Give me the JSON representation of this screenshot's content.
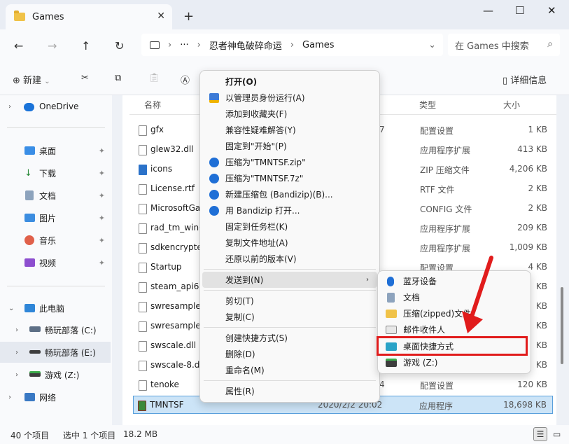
{
  "window": {
    "tab_title": "Games",
    "close_glyph": "✕",
    "newtab_glyph": "+",
    "min_glyph": "—",
    "max_glyph": "☐",
    "winclose_glyph": "✕"
  },
  "nav": {
    "back": "←",
    "forward": "→",
    "up": "↑",
    "refresh": "↻",
    "breadcrumb": [
      "忍者神龟破碎命运",
      "Games"
    ],
    "ellipsis": "···",
    "search_placeholder": "在 Games 中搜索"
  },
  "toolbar": {
    "new_label": "新建",
    "details_label": "详细信息"
  },
  "sidebar": {
    "items": [
      {
        "label": "OneDrive"
      },
      {
        "label": "桌面"
      },
      {
        "label": "下载"
      },
      {
        "label": "文档"
      },
      {
        "label": "图片"
      },
      {
        "label": "音乐"
      },
      {
        "label": "视频"
      },
      {
        "label": "此电脑"
      },
      {
        "label": "畅玩部落 (C:)"
      },
      {
        "label": "畅玩部落 (E:)"
      },
      {
        "label": "游戏 (Z:)"
      },
      {
        "label": "网络"
      }
    ]
  },
  "columns": {
    "name": "名称",
    "type": "类型",
    "size": "大小"
  },
  "files": [
    {
      "name": "gfx",
      "date": "7",
      "type": "配置设置",
      "size": "1 KB"
    },
    {
      "name": "glew32.dll",
      "date": "",
      "type": "应用程序扩展",
      "size": "413 KB"
    },
    {
      "name": "icons",
      "date": "",
      "type": "ZIP 压缩文件",
      "size": "4,206 KB"
    },
    {
      "name": "License.rtf",
      "date": "",
      "type": "RTF 文件",
      "size": "2 KB"
    },
    {
      "name": "MicrosoftGa",
      "date": "",
      "type": "CONFIG 文件",
      "size": "2 KB"
    },
    {
      "name": "rad_tm_win6",
      "date": "",
      "type": "应用程序扩展",
      "size": "209 KB"
    },
    {
      "name": "sdkencrypte",
      "date": "",
      "type": "应用程序扩展",
      "size": "1,009 KB"
    },
    {
      "name": "Startup",
      "date": "",
      "type": "配置设置",
      "size": "4 KB"
    },
    {
      "name": "steam_api64",
      "date": "",
      "type": "",
      "size": "KB"
    },
    {
      "name": "swresample",
      "date": "",
      "type": "",
      "size": "KB"
    },
    {
      "name": "swresample",
      "date": "",
      "type": "",
      "size": "KB"
    },
    {
      "name": "swscale.dll",
      "date": "",
      "type": "",
      "size": "KB"
    },
    {
      "name": "swscale-8.dl",
      "date": "",
      "type": "",
      "size": "KB"
    },
    {
      "name": "tenoke",
      "date": "4",
      "type": "配置设置",
      "size": "120 KB"
    },
    {
      "name": "TMNTSF",
      "date": "2020/2/2 20:02",
      "type": "应用程序",
      "size": "18,698 KB"
    }
  ],
  "context_menu": [
    {
      "label": "打开(O)"
    },
    {
      "label": "以管理员身份运行(A)"
    },
    {
      "label": "添加到收藏夹(F)"
    },
    {
      "label": "兼容性疑难解答(Y)"
    },
    {
      "label": "固定到\"开始\"(P)"
    },
    {
      "label": "压缩为\"TMNTSF.zip\""
    },
    {
      "label": "压缩为\"TMNTSF.7z\""
    },
    {
      "label": "新建压缩包 (Bandizip)(B)..."
    },
    {
      "label": "用 Bandizip 打开..."
    },
    {
      "label": "固定到任务栏(K)"
    },
    {
      "label": "复制文件地址(A)"
    },
    {
      "label": "还原以前的版本(V)"
    },
    {
      "label": "发送到(N)"
    },
    {
      "label": "剪切(T)"
    },
    {
      "label": "复制(C)"
    },
    {
      "label": "创建快捷方式(S)"
    },
    {
      "label": "删除(D)"
    },
    {
      "label": "重命名(M)"
    },
    {
      "label": "属性(R)"
    }
  ],
  "submenu": [
    {
      "label": "蓝牙设备"
    },
    {
      "label": "文档"
    },
    {
      "label": "压缩(zipped)文件"
    },
    {
      "label": "邮件收件人"
    },
    {
      "label": "桌面快捷方式"
    },
    {
      "label": "游戏 (Z:)"
    }
  ],
  "status": {
    "count": "40 个项目",
    "selected": "选中 1 个项目",
    "size": "18.2 MB"
  },
  "colors": {
    "accent": "#1f6fd6",
    "highlight": "#e11c1c",
    "selection": "#cce4f7"
  }
}
